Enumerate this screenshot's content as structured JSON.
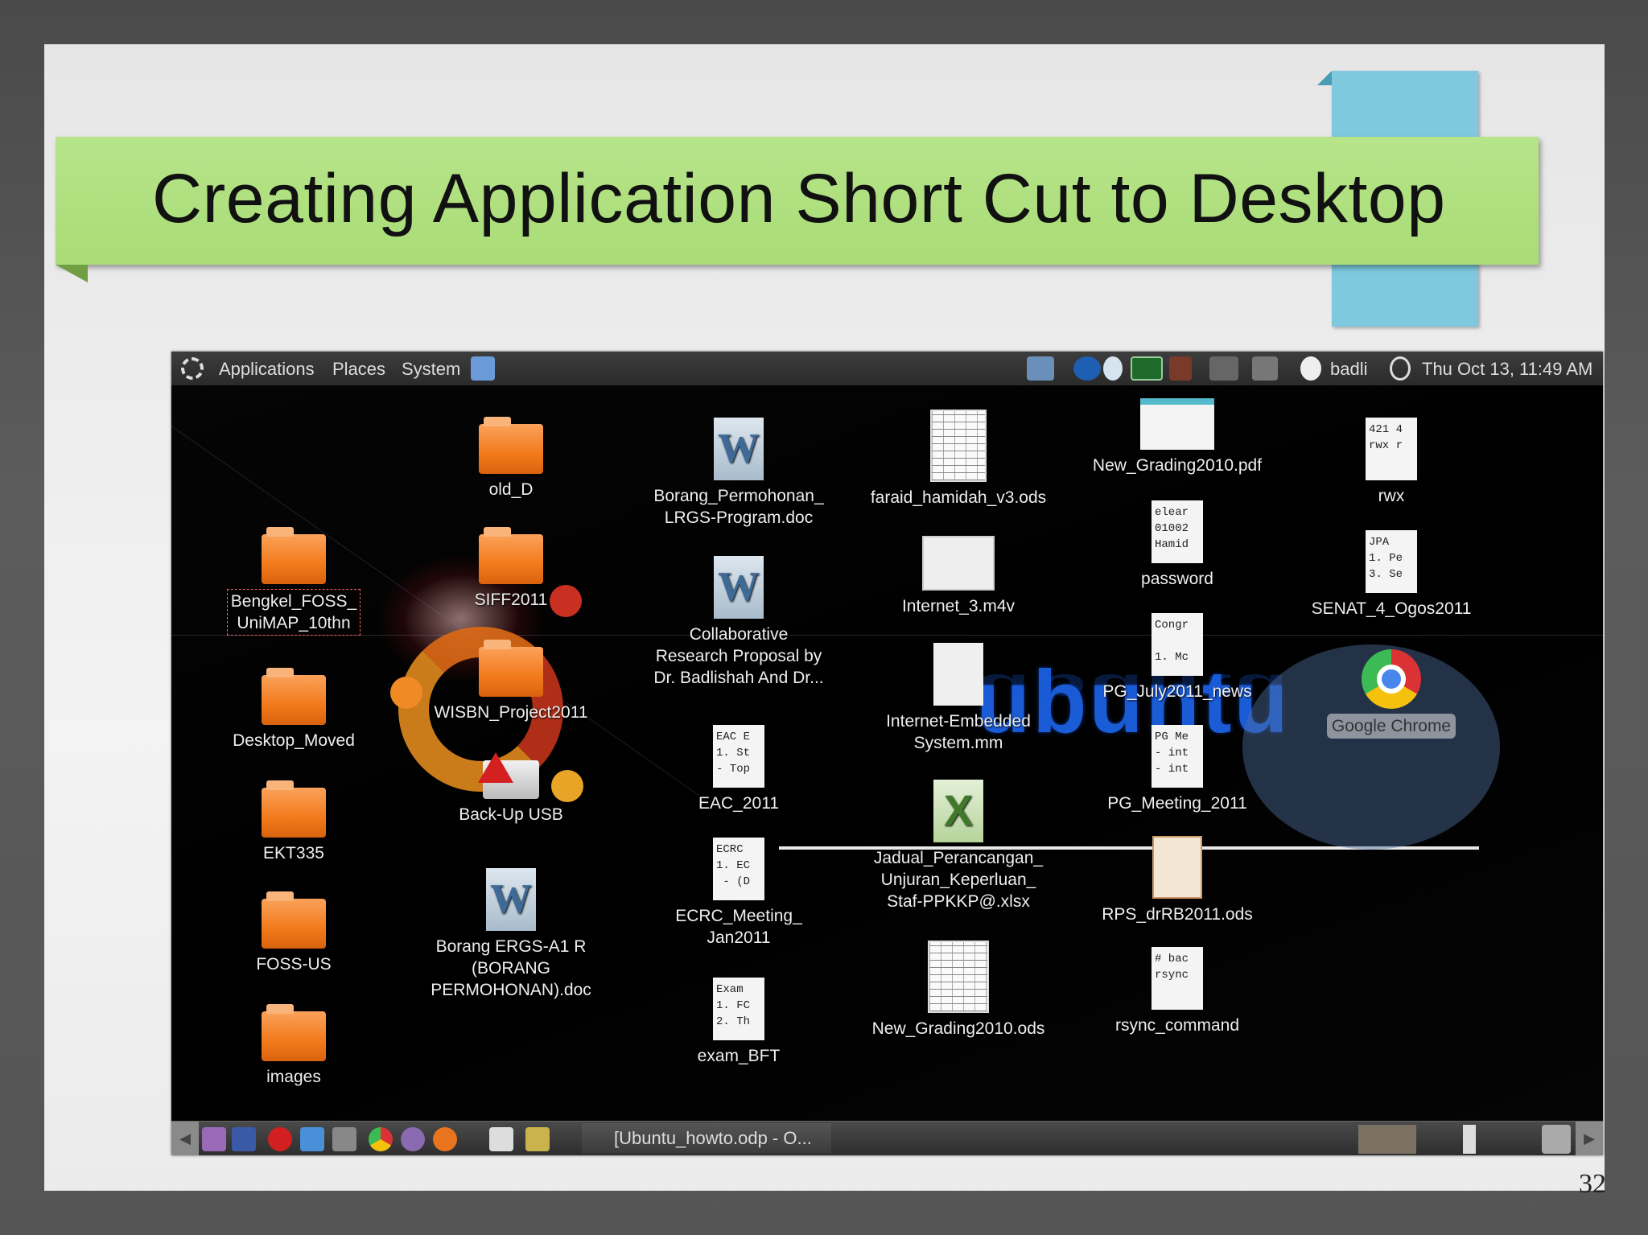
{
  "slide": {
    "title": "Creating Application Short Cut to Desktop",
    "page_number": "32"
  },
  "topbar": {
    "menus": [
      "Applications",
      "Places",
      "System"
    ],
    "user": "badli",
    "clock": "Thu Oct 13, 11:49 AM"
  },
  "desktop": {
    "wallpaper_text": "ubuntu",
    "icons": {
      "old_d": "old_D",
      "siff": "SIFF2011",
      "wisbn": "WISBN_Project2011",
      "backup": "Back-Up USB",
      "borang_ergs": [
        "Borang ERGS-A1 R",
        "(BORANG",
        "PERMOHONAN).doc"
      ],
      "bengkel": [
        "Bengkel_FOSS_",
        "UniMAP_10thn"
      ],
      "desktop_moved": "Desktop_Moved",
      "ekt335": "EKT335",
      "foss_us": "FOSS-US",
      "images": "images",
      "borang_perm": [
        "Borang_Permohonan_",
        "LRGS-Program.doc"
      ],
      "collab": [
        "Collaborative",
        "Research Proposal by",
        "Dr. Badlishah And Dr..."
      ],
      "eac": "EAC_2011",
      "ecrc": [
        "ECRC_Meeting_",
        "Jan2011"
      ],
      "exam": "exam_BFT",
      "faraid": "faraid_hamidah_v3.ods",
      "internet3": "Internet_3.m4v",
      "internet_embedded": [
        "Internet-Embedded",
        "System.mm"
      ],
      "jadual": [
        "Jadual_Perancangan_",
        "Unjuran_Keperluan_",
        "Staf-PPKKP@.xlsx"
      ],
      "new_grading_ods": "New_Grading2010.ods",
      "new_grading_pdf": "New_Grading2010.pdf",
      "password": "password",
      "pg_july": "PG_July2011_news",
      "pg_meeting": "PG_Meeting_2011",
      "rps": "RPS_drRB2011.ods",
      "rsync": "rsync_command",
      "rwx": "rwx",
      "senat": "SENAT_4_Ogos2011",
      "chrome": "Google Chrome"
    },
    "thumbnails": {
      "eac": "EAC E\n1. St\n- Top",
      "ecrc": "ECRC\n1. EC\n - (D",
      "exam": "Exam\n1. FC\n2. Th",
      "password": "elear\n01002\nHamid",
      "pg_july": "Congr\n\n1. Mc",
      "pg_meeting": "PG Me\n- int\n- int",
      "rsync": "# bac\nrsync",
      "rwx": "421 4\nrwx r",
      "senat": "JPA\n1. Pe\n3. Se"
    }
  },
  "taskbar": {
    "task_label": "[Ubuntu_howto.odp - O..."
  }
}
